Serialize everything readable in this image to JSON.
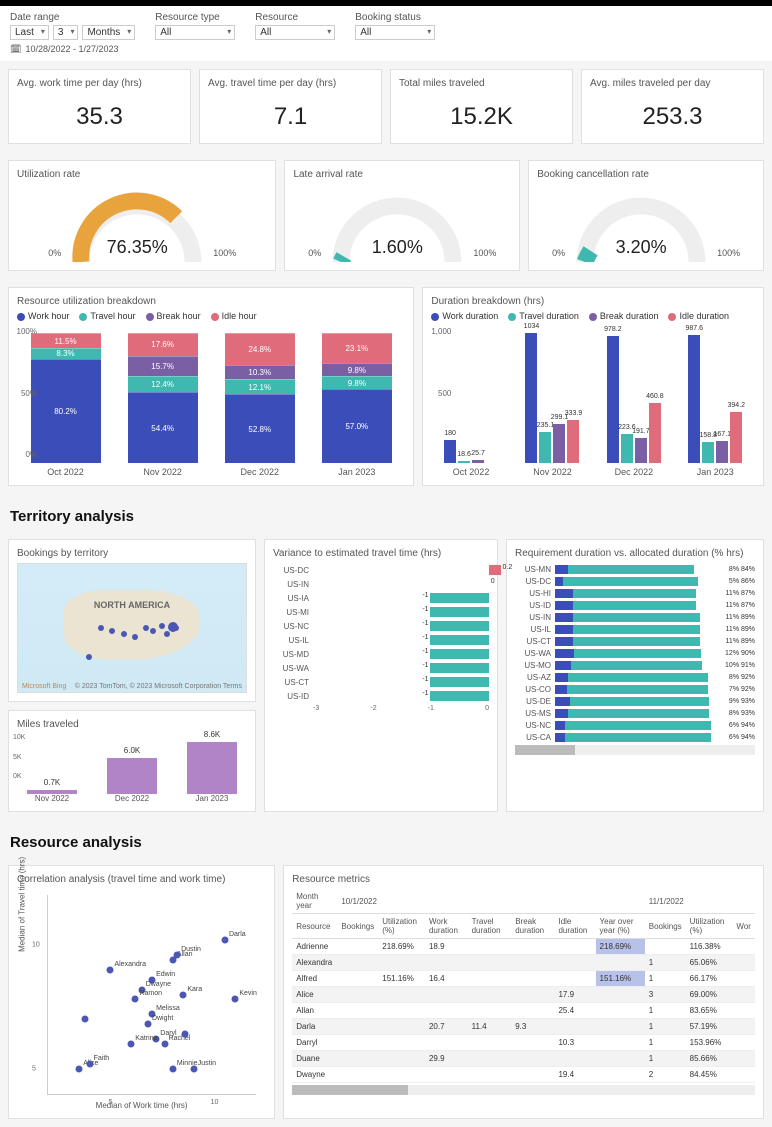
{
  "filters": {
    "date_range_label": "Date range",
    "date_range_last": "Last",
    "date_range_num": "3",
    "date_range_unit": "Months",
    "resource_type_label": "Resource type",
    "resource_type_val": "All",
    "resource_label": "Resource",
    "resource_val": "All",
    "booking_status_label": "Booking status",
    "booking_status_val": "All",
    "date_span": "10/28/2022 - 1/27/2023"
  },
  "kpis": {
    "work_time_label": "Avg. work time per day (hrs)",
    "work_time_val": "35.3",
    "travel_time_label": "Avg. travel time per day (hrs)",
    "travel_time_val": "7.1",
    "miles_label": "Total miles traveled",
    "miles_val": "15.2K",
    "avg_miles_label": "Avg. miles traveled per day",
    "avg_miles_val": "253.3"
  },
  "gauges": {
    "util_label": "Utilization rate",
    "util_val": "76.35%",
    "late_label": "Late arrival rate",
    "late_val": "1.60%",
    "cancel_label": "Booking cancellation rate",
    "cancel_val": "3.20%",
    "min": "0%",
    "max": "100%"
  },
  "breakdown1": {
    "title": "Resource utilization breakdown",
    "legend": [
      "Work hour",
      "Travel hour",
      "Break hour",
      "Idle hour"
    ]
  },
  "breakdown2": {
    "title": "Duration breakdown (hrs)",
    "legend": [
      "Work duration",
      "Travel duration",
      "Break duration",
      "Idle duration"
    ]
  },
  "territory": {
    "head": "Territory analysis",
    "map_title": "Bookings by territory",
    "map_label": "NORTH AMERICA",
    "map_attr": "© 2023 TomTom, © 2023 Microsoft Corporation Terms",
    "map_corner": "Microsoft Bing",
    "miles_title": "Miles traveled",
    "variance_title": "Variance to estimated travel time (hrs)",
    "reqdur_title": "Requirement duration vs. allocated duration (% hrs)"
  },
  "resource": {
    "head": "Resource analysis",
    "scatter_title": "Correlation analysis (travel time and work time)",
    "scatter_xlabel": "Median of Work time (hrs)",
    "scatter_ylabel": "Median of Travel time (hrs)",
    "metrics_title": "Resource metrics",
    "month_year_label": "Month year",
    "group1": "10/1/2022",
    "group2": "11/1/2022",
    "cols": [
      "Resource",
      "Bookings",
      "Utilization (%)",
      "Work duration",
      "Travel duration",
      "Break duration",
      "Idle duration",
      "Year over year (%)",
      "Bookings",
      "Utilization (%)",
      "Wor"
    ]
  },
  "chart_data": [
    {
      "type": "bar",
      "subtype": "stacked-percent",
      "title": "Resource utilization breakdown",
      "categories": [
        "Oct 2022",
        "Nov 2022",
        "Dec 2022",
        "Jan 2023"
      ],
      "series": [
        {
          "name": "Work hour",
          "values": [
            80.2,
            54.4,
            52.8,
            57.0
          ],
          "color": "#3b4db8"
        },
        {
          "name": "Travel hour",
          "values": [
            8.3,
            12.4,
            12.1,
            9.8
          ],
          "color": "#3fb8af"
        },
        {
          "name": "Break hour",
          "values": [
            0.0,
            15.7,
            10.3,
            9.8
          ],
          "color": "#7b5fa5"
        },
        {
          "name": "Idle hour",
          "values": [
            11.5,
            17.6,
            24.8,
            23.1
          ],
          "color": "#e06b7a"
        }
      ],
      "ylim": [
        0,
        100
      ],
      "yticks": [
        0,
        50,
        100
      ]
    },
    {
      "type": "bar",
      "subtype": "grouped",
      "title": "Duration breakdown (hrs)",
      "categories": [
        "Oct 2022",
        "Nov 2022",
        "Dec 2022",
        "Jan 2023"
      ],
      "series": [
        {
          "name": "Work duration",
          "values": [
            180.0,
            1034.0,
            978.2,
            987.6
          ],
          "color": "#3b4db8"
        },
        {
          "name": "Travel duration",
          "values": [
            18.6,
            235.1,
            223.6,
            158.8
          ],
          "color": "#3fb8af"
        },
        {
          "name": "Break duration",
          "values": [
            25.7,
            299.1,
            191.7,
            167.1
          ],
          "color": "#7b5fa5"
        },
        {
          "name": "Idle duration",
          "values": [
            0,
            333.9,
            460.8,
            394.2
          ],
          "color": "#e06b7a"
        }
      ],
      "ylim": [
        0,
        1000
      ],
      "yticks": [
        0,
        500,
        1000
      ]
    },
    {
      "type": "bar",
      "title": "Miles traveled",
      "categories": [
        "Nov 2022",
        "Dec 2022",
        "Jan 2023"
      ],
      "values_label": [
        "0.7K",
        "6.0K",
        "8.6K"
      ],
      "values": [
        700,
        6000,
        8600
      ],
      "ylim": [
        0,
        10000
      ],
      "yticks": [
        "0K",
        "5K",
        "10K"
      ],
      "color": "#b184c7"
    },
    {
      "type": "bar",
      "subtype": "h-diverging",
      "title": "Variance to estimated travel time (hrs)",
      "categories": [
        "US-DC",
        "US-IN",
        "US-IA",
        "US-MI",
        "US-NC",
        "US-IL",
        "US-MD",
        "US-WA",
        "US-CT",
        "US-ID"
      ],
      "values": [
        0.2,
        0,
        -1,
        -1,
        -1,
        -1,
        -1,
        -1,
        -1,
        -1
      ],
      "xlim": [
        -3,
        0
      ],
      "xticks": [
        -3,
        -2,
        -1,
        0
      ],
      "color_neg": "#3fb8af",
      "color_pos": "#e06b7a"
    },
    {
      "type": "bar",
      "subtype": "h-stacked",
      "title": "Requirement duration vs. allocated duration (% hrs)",
      "categories": [
        "US-MN",
        "US-DC",
        "US-HI",
        "US-ID",
        "US-IN",
        "US-IL",
        "US-CT",
        "US-WA",
        "US-MO",
        "US-AZ",
        "US-CO",
        "US-DE",
        "US-MS",
        "US-NC",
        "US-CA"
      ],
      "series": [
        {
          "name": "Requirement",
          "values": [
            8,
            5,
            11,
            11,
            11,
            11,
            11,
            12,
            10,
            8,
            7,
            9,
            8,
            6,
            6
          ],
          "color": "#3b4db8"
        },
        {
          "name": "Allocated",
          "values": [
            84,
            86,
            87,
            87,
            89,
            89,
            89,
            90,
            91,
            92,
            92,
            93,
            93,
            94,
            94
          ],
          "color": "#3fb8af"
        }
      ]
    },
    {
      "type": "scatter",
      "title": "Correlation analysis (travel time and work time)",
      "xlabel": "Median of Work time (hrs)",
      "ylabel": "Median of Travel time (hrs)",
      "points": [
        {
          "name": "Alice",
          "x": 3.5,
          "y": 5.0
        },
        {
          "name": "Faith",
          "x": 4.0,
          "y": 5.2
        },
        {
          "name": "Alexandra",
          "x": 5.0,
          "y": 9.0
        },
        {
          "name": "Edwin",
          "x": 7.0,
          "y": 8.6
        },
        {
          "name": "Dwayne",
          "x": 6.5,
          "y": 8.2
        },
        {
          "name": "Ramon",
          "x": 6.2,
          "y": 7.8
        },
        {
          "name": "Allan",
          "x": 8.0,
          "y": 9.4
        },
        {
          "name": "Dustin",
          "x": 8.2,
          "y": 9.6
        },
        {
          "name": "Kara",
          "x": 8.5,
          "y": 8.0
        },
        {
          "name": "Melissa",
          "x": 7.0,
          "y": 7.2
        },
        {
          "name": "Dwight",
          "x": 6.8,
          "y": 6.8
        },
        {
          "name": "Daryl",
          "x": 7.2,
          "y": 6.2
        },
        {
          "name": "Rachel",
          "x": 7.6,
          "y": 6.0
        },
        {
          "name": "Katrina",
          "x": 6.0,
          "y": 6.0
        },
        {
          "name": "Minnie",
          "x": 8.0,
          "y": 5.0
        },
        {
          "name": "Justin",
          "x": 9.0,
          "y": 5.0
        },
        {
          "name": "Darla",
          "x": 10.5,
          "y": 10.2
        },
        {
          "name": "Kevin",
          "x": 11.0,
          "y": 7.8
        },
        {
          "name": "",
          "x": 3.8,
          "y": 7.0
        },
        {
          "name": "",
          "x": 8.6,
          "y": 6.4
        }
      ],
      "xlim": [
        2,
        12
      ],
      "ylim": [
        4,
        12
      ],
      "xticks": [
        5,
        10
      ],
      "yticks": [
        5,
        10
      ]
    },
    {
      "type": "table",
      "title": "Resource metrics",
      "group1": "10/1/2022",
      "group2": "11/1/2022",
      "columns": [
        "Resource",
        "Bookings",
        "Utilization (%)",
        "Work duration",
        "Travel duration",
        "Break duration",
        "Idle duration",
        "Year over year (%)",
        "Bookings",
        "Utilization (%)"
      ],
      "rows": [
        {
          "Resource": "Adrienne",
          "Utilization": "218.69%",
          "Work": 18.9,
          "YoY": "218.69%",
          "Bookings2": "",
          "Util2": "116.38%"
        },
        {
          "Resource": "Alexandra",
          "Bookings2": 1,
          "Util2": "65.06%"
        },
        {
          "Resource": "Alfred",
          "Utilization": "151.16%",
          "Work": 16.4,
          "YoY": "151.16%",
          "Bookings2": 1,
          "Util2": "66.17%"
        },
        {
          "Resource": "Alice",
          "Idle": 17.9,
          "Bookings2": 3,
          "Util2": "69.00%"
        },
        {
          "Resource": "Allan",
          "Idle": 25.4,
          "Bookings2": 1,
          "Util2": "83.65%"
        },
        {
          "Resource": "Darla",
          "Work": 20.7,
          "Travel": 11.4,
          "Break": 9.3,
          "Bookings2": 1,
          "Util2": "57.19%"
        },
        {
          "Resource": "Darryl",
          "Idle": 10.3,
          "Bookings2": 1,
          "Util2": "153.96%"
        },
        {
          "Resource": "Duane",
          "Work": 29.9,
          "Bookings2": 1,
          "Util2": "85.66%"
        },
        {
          "Resource": "Dwayne",
          "Idle": 19.4,
          "Bookings2": 2,
          "Util2": "84.45%"
        }
      ]
    }
  ]
}
